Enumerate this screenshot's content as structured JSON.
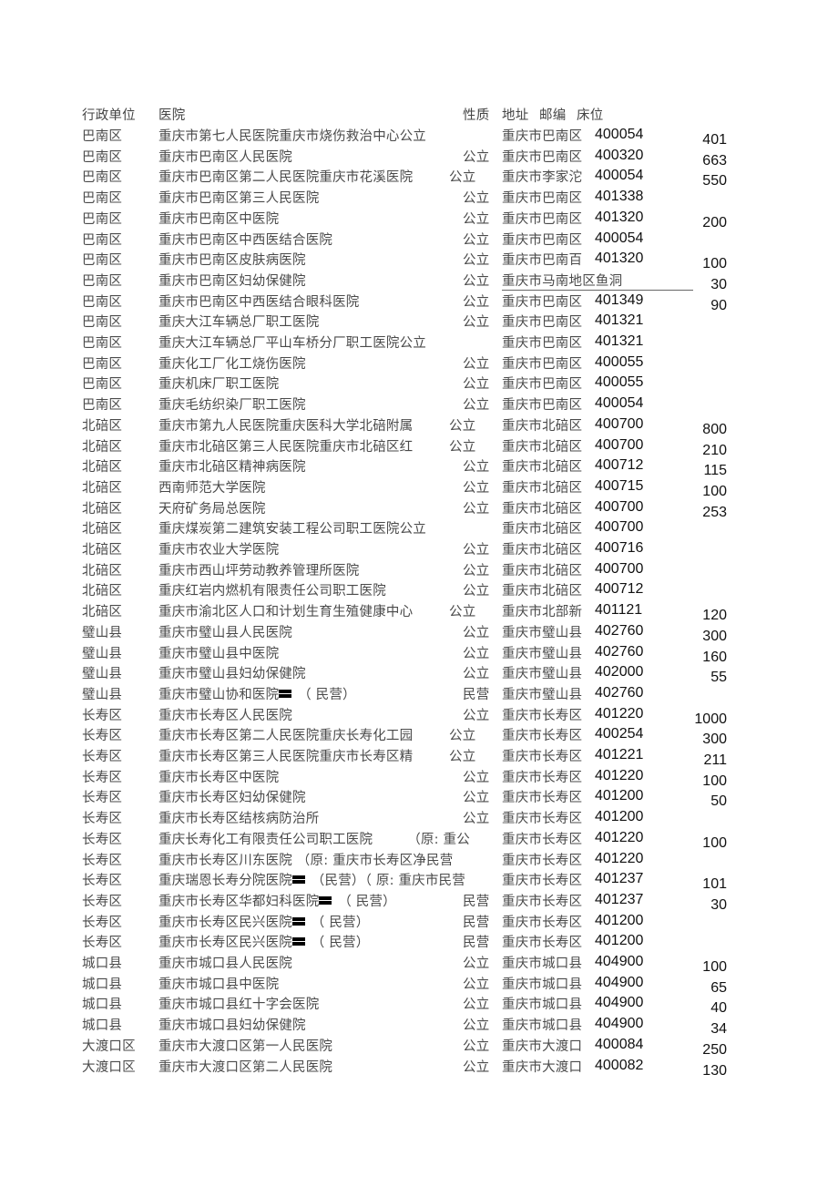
{
  "header": {
    "unit": "行政单位",
    "hospital": "医院",
    "type": "性质",
    "address": "地址",
    "zip": "邮编",
    "beds": "床位"
  },
  "rows": [
    {
      "unit": "巴南区",
      "hospital": "重庆市第七人民医院重庆市烧伤救治中心公立",
      "type": "",
      "address": "重庆市巴南区",
      "zip": "400054",
      "beds": "401"
    },
    {
      "unit": "巴南区",
      "hospital": "重庆市巴南区人民医院",
      "type": "公立",
      "address": "重庆市巴南区",
      "zip": "400320",
      "beds": "663"
    },
    {
      "unit": "巴南区",
      "hospital": "重庆市巴南区第二人民医院重庆市花溪医院",
      "type": "公立",
      "address": "重庆市李家沱",
      "zip": "400054",
      "beds": "550",
      "type_inline": true
    },
    {
      "unit": "巴南区",
      "hospital": "重庆市巴南区第三人民医院",
      "type": "公立",
      "address": "重庆市巴南区",
      "zip": "401338",
      "beds": ""
    },
    {
      "unit": "巴南区",
      "hospital": "重庆市巴南区中医院",
      "type": "公立",
      "address": "重庆市巴南区",
      "zip": "401320",
      "beds": "200"
    },
    {
      "unit": "巴南区",
      "hospital": "重庆市巴南区中西医结合医院",
      "type": "公立",
      "address": "重庆市巴南区",
      "zip": "400054",
      "beds": ""
    },
    {
      "unit": "巴南区",
      "hospital": "重庆市巴南区皮肤病医院",
      "type": "公立",
      "address": "重庆市巴南百",
      "zip": "401320",
      "beds": "100"
    },
    {
      "unit": "巴南区",
      "hospital": "重庆市巴南区妇幼保健院",
      "type": "公立",
      "address": "重庆市马南地区鱼洞",
      "zip": "",
      "beds": "30"
    },
    {
      "unit": "巴南区",
      "hospital": "重庆市巴南区中西医结合眼科医院",
      "type": "公立",
      "address": "重庆市巴南区",
      "zip": "401349",
      "beds": "90"
    },
    {
      "unit": "巴南区",
      "hospital": "重庆大江车辆总厂职工医院",
      "type": "公立",
      "address": "重庆市巴南区",
      "zip": "401321",
      "beds": ""
    },
    {
      "unit": "巴南区",
      "hospital": "重庆大江车辆总厂平山车桥分厂职工医院公立",
      "type": "",
      "address": "重庆市巴南区",
      "zip": "401321",
      "beds": ""
    },
    {
      "unit": "巴南区",
      "hospital": "重庆化工厂化工烧伤医院",
      "type": "公立",
      "address": "重庆市巴南区",
      "zip": "400055",
      "beds": ""
    },
    {
      "unit": "巴南区",
      "hospital": "重庆机床厂职工医院",
      "type": "公立",
      "address": "重庆市巴南区",
      "zip": "400055",
      "beds": ""
    },
    {
      "unit": "巴南区",
      "hospital": "重庆毛纺织染厂职工医院",
      "type": "公立",
      "address": "重庆市巴南区",
      "zip": "400054",
      "beds": ""
    },
    {
      "unit": "北碚区",
      "hospital": "重庆市第九人民医院重庆医科大学北碚附属",
      "type": "公立",
      "address": "重庆市北碚区",
      "zip": "400700",
      "beds": "800",
      "type_inline": true
    },
    {
      "unit": "北碚区",
      "hospital": "重庆市北碚区第三人民医院重庆市北碚区红",
      "type": "公立",
      "address": "重庆市北碚区",
      "zip": "400700",
      "beds": "210",
      "type_inline": true
    },
    {
      "unit": "北碚区",
      "hospital": "重庆市北碚区精神病医院",
      "type": "公立",
      "address": "重庆市北碚区",
      "zip": "400712",
      "beds": "115"
    },
    {
      "unit": "北碚区",
      "hospital": "西南师范大学医院",
      "type": "公立",
      "address": "重庆市北碚区",
      "zip": "400715",
      "beds": "100"
    },
    {
      "unit": "北碚区",
      "hospital": "天府矿务局总医院",
      "type": "公立",
      "address": "重庆市北碚区",
      "zip": "400700",
      "beds": "253"
    },
    {
      "unit": "北碚区",
      "hospital": "重庆煤炭第二建筑安装工程公司职工医院公立",
      "type": "",
      "address": "重庆市北碚区",
      "zip": "400700",
      "beds": ""
    },
    {
      "unit": "北碚区",
      "hospital": "重庆市农业大学医院",
      "type": "公立",
      "address": "重庆市北碚区",
      "zip": "400716",
      "beds": ""
    },
    {
      "unit": "北碚区",
      "hospital": "重庆市西山坪劳动教养管理所医院",
      "type": "公立",
      "address": "重庆市北碚区",
      "zip": "400700",
      "beds": ""
    },
    {
      "unit": "北碚区",
      "hospital": "重庆红岩内燃机有限责任公司职工医院",
      "type": "公立",
      "address": "重庆市北碚区",
      "zip": "400712",
      "beds": ""
    },
    {
      "unit": "北碚区",
      "hospital": "重庆市渝北区人口和计划生育生殖健康中心",
      "type": "公立",
      "address": "重庆市北部新",
      "zip": "401121",
      "beds": "120",
      "type_inline": true
    },
    {
      "unit": "璧山县",
      "hospital": "重庆市璧山县人民医院",
      "type": "公立",
      "address": "重庆市璧山县",
      "zip": "402760",
      "beds": "300"
    },
    {
      "unit": "璧山县",
      "hospital": "重庆市璧山县中医院",
      "type": "公立",
      "address": "重庆市璧山县",
      "zip": "402760",
      "beds": "160"
    },
    {
      "unit": "璧山县",
      "hospital": "重庆市璧山县妇幼保健院",
      "type": "公立",
      "address": "重庆市璧山县",
      "zip": "402000",
      "beds": "55"
    },
    {
      "unit": "璧山县",
      "hospital": "重庆市璧山协和医院",
      "hospital_suffix": "（ 民营）",
      "mark": true,
      "type": "民营",
      "address": "重庆市璧山县",
      "zip": "402760",
      "beds": ""
    },
    {
      "unit": "长寿区",
      "hospital": "重庆市长寿区人民医院",
      "type": "公立",
      "address": "重庆市长寿区",
      "zip": "401220",
      "beds": "1000"
    },
    {
      "unit": "长寿区",
      "hospital": "重庆市长寿区第二人民医院重庆长寿化工园",
      "type": "公立",
      "address": "重庆市长寿区",
      "zip": "400254",
      "beds": "300",
      "type_inline": true
    },
    {
      "unit": "长寿区",
      "hospital": "重庆市长寿区第三人民医院重庆市长寿区精",
      "type": "公立",
      "address": "重庆市长寿区",
      "zip": "401221",
      "beds": "211",
      "type_inline": true
    },
    {
      "unit": "长寿区",
      "hospital": "重庆市长寿区中医院",
      "type": "公立",
      "address": "重庆市长寿区",
      "zip": "401220",
      "beds": "100"
    },
    {
      "unit": "长寿区",
      "hospital": "重庆市长寿区妇幼保健院",
      "type": "公立",
      "address": "重庆市长寿区",
      "zip": "401200",
      "beds": "50"
    },
    {
      "unit": "长寿区",
      "hospital": "重庆市长寿区结核病防治所",
      "type": "公立",
      "address": "重庆市长寿区",
      "zip": "401200",
      "beds": ""
    },
    {
      "unit": "长寿区",
      "hospital": "重庆长寿化工有限责任公司职工医院",
      "hospital_tail": "（原: 重公",
      "type": "",
      "address": "重庆市长寿区",
      "zip": "401220",
      "beds": "100",
      "addr_tight": true
    },
    {
      "unit": "长寿区",
      "hospital": "重庆市长寿区川东医院 （原: 重庆市长寿区净民营",
      "type": "",
      "address": "重庆市长寿区",
      "zip": "401220",
      "beds": ""
    },
    {
      "unit": "长寿区",
      "hospital": "重庆瑞恩长寿分院医院",
      "mark": true,
      "hospital_suffix": "（民营）（ 原: 重庆市民营",
      "type": "",
      "address": "重庆市长寿区",
      "zip": "401237",
      "beds": "101",
      "addr_tight": true
    },
    {
      "unit": "长寿区",
      "hospital": "重庆市长寿区华都妇科医院",
      "mark": true,
      "hospital_suffix": "（ 民营）",
      "type": "民营",
      "address": "重庆市长寿区",
      "zip": "401237",
      "beds": "30"
    },
    {
      "unit": "长寿区",
      "hospital": "重庆市长寿区民兴医院",
      "mark": true,
      "hospital_suffix": "（ 民营）",
      "type": "民营",
      "address": "重庆市长寿区",
      "zip": "401200",
      "beds": ""
    },
    {
      "unit": "长寿区",
      "hospital": "重庆市长寿区民兴医院",
      "mark": true,
      "hospital_suffix": "（ 民营）",
      "type": "民营",
      "address": "重庆市长寿区",
      "zip": "401200",
      "beds": ""
    },
    {
      "unit": "城口县",
      "hospital": "重庆市城口县人民医院",
      "type": "公立",
      "address": "重庆市城口县",
      "zip": "404900",
      "beds": "100"
    },
    {
      "unit": "城口县",
      "hospital": "重庆市城口县中医院",
      "type": "公立",
      "address": "重庆市城口县",
      "zip": "404900",
      "beds": "65"
    },
    {
      "unit": "城口县",
      "hospital": "重庆市城口县红十字会医院",
      "type": "公立",
      "address": "重庆市城口县",
      "zip": "404900",
      "beds": "40"
    },
    {
      "unit": "城口县",
      "hospital": "重庆市城口县妇幼保健院",
      "type": "公立",
      "address": "重庆市城口县",
      "zip": "404900",
      "beds": "34"
    },
    {
      "unit": "大渡口区",
      "hospital": "重庆市大渡口区第一人民医院",
      "type": "公立",
      "address": "重庆市大渡口",
      "zip": "400084",
      "beds": "250"
    },
    {
      "unit": "大渡口区",
      "hospital": "重庆市大渡口区第二人民医院",
      "type": "公立",
      "address": "重庆市大渡口",
      "zip": "400082",
      "beds": "130"
    }
  ]
}
